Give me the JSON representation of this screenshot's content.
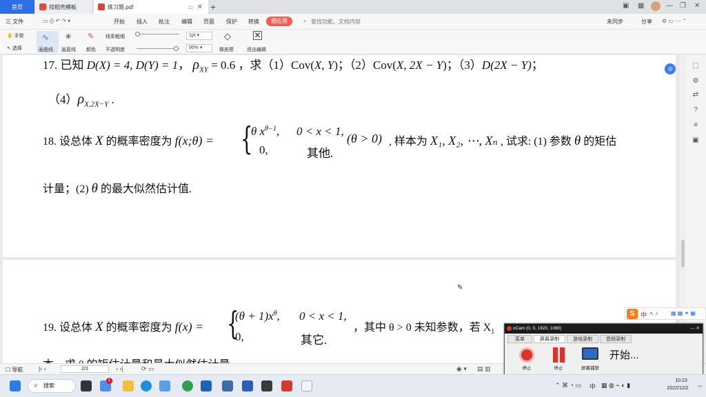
{
  "tabs": [
    {
      "label": "首页"
    },
    {
      "label": "找稻壳模板"
    },
    {
      "label": "练习题.pdf"
    }
  ],
  "menu": {
    "items": [
      "三 文件",
      "开始",
      "插入",
      "批注",
      "编辑",
      "页面",
      "保护",
      "转换"
    ],
    "active": "圈应用",
    "search": "查找功能、文档内容",
    "right": [
      "未同步",
      "分享"
    ]
  },
  "toolbar": {
    "hand": "手型",
    "select": "选择",
    "curve": "画曲线",
    "straight": "画直线",
    "color": "颜色",
    "thickness": "线条粗细",
    "opacity": "不透明度",
    "thickness_value": "1pt",
    "opacity_value": "96%",
    "eraser": "橡皮擦",
    "exit": "退出编辑"
  },
  "doc": {
    "q17_line1_a": "17. 已知 ",
    "q17_line1_b": "D(X) = 4, D(Y) = 1",
    "q17_line1_c": "，",
    "q17_rho": "ρ",
    "q17_rho_sub": "XY",
    "q17_line1_d": " = 0.6 ，求（1）Cov(",
    "q17_cov1": "X, Y",
    "q17_line1_e": ")；（2）Cov(",
    "q17_cov2": "X, 2X − Y",
    "q17_line1_f": ")；（3）",
    "q17_d": "D(2X − Y)",
    "q17_line1_g": "；",
    "q17_line2_a": "（4）",
    "q17_line2_rho": "ρ",
    "q17_line2_sub": "X,2X−Y",
    "q17_line2_end": " .",
    "q18_a": "18. 设总体 ",
    "q18_X": "X",
    "q18_b": " 的概率密度为 ",
    "q18_f": "f(x;θ) =",
    "q18_case1": "θ x",
    "q18_case1_sup": "θ−1",
    "q18_case1_comma": ",",
    "q18_cond1": "0 < x < 1,",
    "q18_case2": "0,",
    "q18_cond2": "其他.",
    "q18_theta": "(θ > 0)",
    "q18_c": ", 样本为 ",
    "q18_sample": "X₁, X₂, ⋯, Xₙ",
    "q18_d": " , 试求: (1) 参数 ",
    "q18_th": "θ",
    "q18_e": " 的矩估",
    "q18_line2_a": "计量；(2) ",
    "q18_line2_th": "θ",
    "q18_line2_b": " 的最大似然估计值.",
    "q19_a": "19. 设总体 ",
    "q19_X": "X",
    "q19_b": " 的概率密度为 ",
    "q19_f": "f(x) =",
    "q19_case1": "(θ + 1)x",
    "q19_case1_sup": "θ",
    "q19_case1_comma": ",",
    "q19_cond1": "0 < x < 1,",
    "q19_case2": "0,",
    "q19_cond2": "其它.",
    "q19_c": "，其中 θ > 0 未知参数，若 X",
    "q19_d": "1",
    "q19_line2": "本，求 θ 的矩估计量和最大似然估计量。"
  },
  "status": {
    "nav": "导航",
    "page": "2/3"
  },
  "ocam": {
    "title": "oCam (0, 0, 1920, 1080)",
    "tabs": [
      "菜单",
      "屏幕录制",
      "游戏录制",
      "音频录制"
    ],
    "buttons": [
      "停止",
      "停止",
      "屏幕捕获"
    ],
    "status": "开始..."
  },
  "ime": {
    "label": "中",
    "extras": "•, ♪"
  },
  "taskbar": {
    "search": "搜索",
    "badge": "1",
    "ime": "中",
    "time": "10:23",
    "date": "2022/12/2"
  },
  "colors": {
    "accent": "#2e6fe8",
    "active_menu": "#f25c54",
    "ocam_title": "#1b1b1b",
    "ocam_record": "#d9342b"
  }
}
